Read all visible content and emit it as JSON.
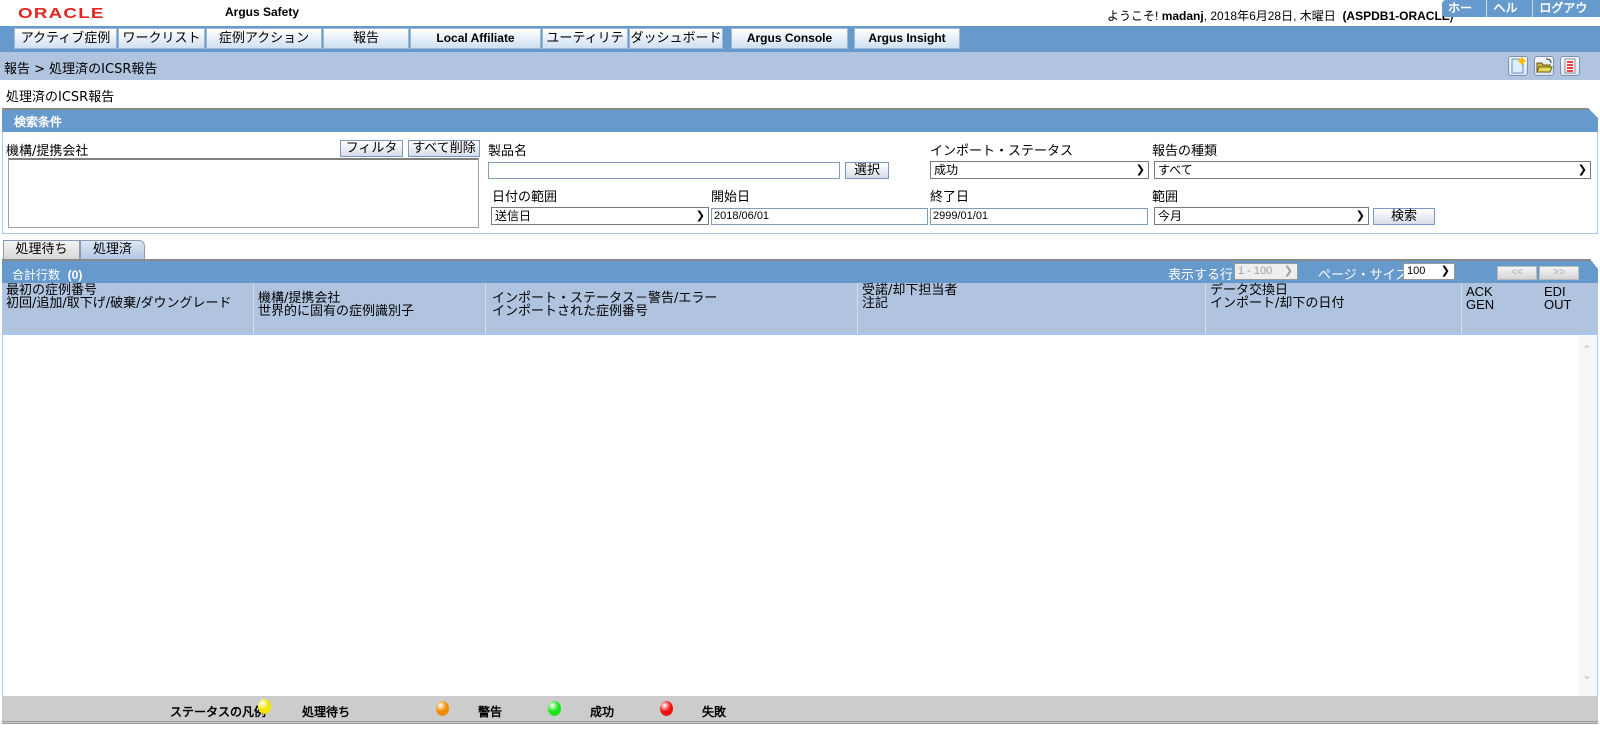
{
  "header": {
    "logo": "ORACLE",
    "app_title": "Argus Safety",
    "welcome_prefix": "ようこそ!",
    "user": "madanj",
    "date": ", 2018年6月28日, 木曜日",
    "db": "(ASPDB1-ORACLE)",
    "links": [
      "ホーム",
      "ヘルプ",
      "ログアウト"
    ]
  },
  "nav": {
    "items": [
      "アクティブ症例",
      "ワークリスト",
      "症例アクション",
      "報告",
      "Local Affiliate",
      "ユーティリティ",
      "ダッシュボード",
      "Argus Console",
      "Argus Insight"
    ]
  },
  "breadcrumb": "報告 > 処理済のICSR報告",
  "toolbar_icons": [
    "new-document-icon",
    "open-folder-icon",
    "report-list-icon"
  ],
  "page_heading": "処理済のICSR報告",
  "search": {
    "title": "検索条件",
    "org_label": "機構/提携会社",
    "filter_btn": "フィルタ",
    "clear_btn": "すべて削除",
    "product_label": "製品名",
    "product_value": "",
    "select_btn": "選択",
    "import_status_label": "インポート・ステータス",
    "import_status_value": "成功",
    "report_type_label": "報告の種類",
    "report_type_value": "すべて",
    "date_range_label": "日付の範囲",
    "date_range_value": "送信日",
    "start_label": "開始日",
    "start_value": "2018/06/01",
    "end_label": "終了日",
    "end_value": "2999/01/01",
    "range_label": "範囲",
    "range_value": "今月",
    "search_btn": "検索"
  },
  "tabs": [
    {
      "label": "処理待ち",
      "active": false
    },
    {
      "label": "処理済",
      "active": true
    }
  ],
  "grid": {
    "count_label": "合計行数",
    "count_value": "(0)",
    "rows_label": "表示する行",
    "rows_value": "1 - 100",
    "page_size_label": "ページ・サイズ",
    "page_size_value": "100",
    "prev": "<<",
    "next": ">>",
    "columns": [
      {
        "line1": "最初の症例番号",
        "line2": "初回/追加/取下げ/破棄/ダウングレード"
      },
      {
        "line1": "機構/提携会社",
        "line2": "世界的に固有の症例識別子"
      },
      {
        "line1": "インポート・ステータス－警告/エラー",
        "line2": "インポートされた症例番号"
      },
      {
        "line1": "受諾/却下担当者",
        "line2": "注記"
      },
      {
        "line1": "データ交換日",
        "line2": "インポート/却下の日付"
      },
      {
        "line1": "ACK",
        "line2": "GEN"
      },
      {
        "line1": "EDI",
        "line2": "OUT"
      }
    ],
    "rows": []
  },
  "legend": {
    "title": "ステータスの凡例",
    "items": [
      {
        "label": "処理待ち",
        "color": "#f2e600"
      },
      {
        "label": "警告",
        "color": "#f08c00"
      },
      {
        "label": "成功",
        "color": "#19e619"
      },
      {
        "label": "失敗",
        "color": "#f01010"
      }
    ]
  }
}
